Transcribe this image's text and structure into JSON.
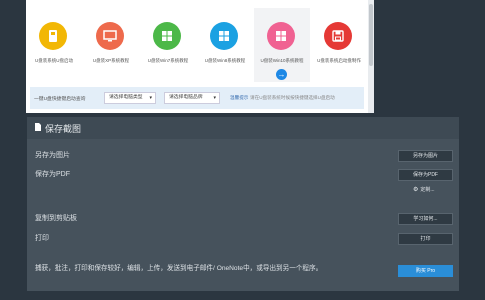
{
  "preview": {
    "os_items": [
      {
        "label": "U盘装系统U盘启动",
        "color": "#f2b705",
        "icon": "usb-drive-icon"
      },
      {
        "label": "U盘装XP系统教程",
        "color": "#ee6a4c",
        "icon": "monitor-icon"
      },
      {
        "label": "U盘装Win7系统教程",
        "color": "#4cb848",
        "icon": "windows-logo-icon"
      },
      {
        "label": "U盘装Win8系统教程",
        "color": "#1ba1e2",
        "icon": "windows-logo-icon"
      },
      {
        "label": "U盘装Win10系统教程",
        "color": "#f06292",
        "icon": "windows-logo-icon"
      },
      {
        "label": "U盘装系统启动盘制作",
        "color": "#e53935",
        "icon": "save-disk-icon"
      }
    ],
    "filter_prompt": "一键U盘快捷键启动查询",
    "dropdown_brand": "请选择电脑类型",
    "dropdown_model": "请选择电脑品牌",
    "tip_title": "温馨提示",
    "tip_text": "请在U盘装系统时候按快捷键选择U盘启动"
  },
  "panel": {
    "title": "保存截图",
    "row_save_image": "另存为图片",
    "row_save_pdf": "保存为PDF",
    "row_copy": "复制到剪贴板",
    "row_print": "打印",
    "btn_save_image": "另存为图片",
    "btn_save_pdf": "保存为PDF",
    "link_custom": "定制...",
    "btn_learn_more": "学习如何...",
    "btn_print": "打印",
    "btn_buy_pro": "购买 Pro",
    "description": "捕获，批注，打印和保存较好，编辑，上传，发送到电子邮件/ OneNote中，或导出到另一个程序。"
  }
}
